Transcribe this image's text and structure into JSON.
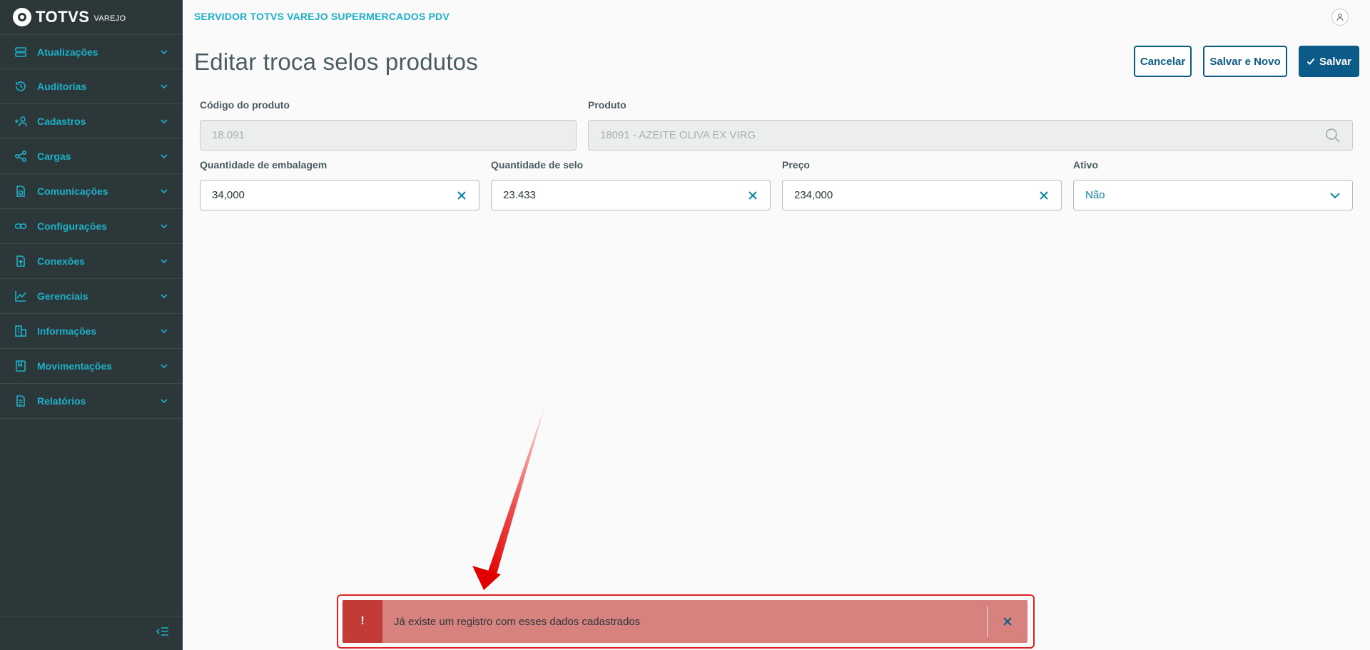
{
  "app": {
    "logo_text": "TOTVS",
    "logo_sub": "VAREJO",
    "title": "SERVIDOR TOTVS VAREJO SUPERMERCADOS PDV"
  },
  "sidebar": {
    "items": [
      {
        "label": "Atualizações",
        "icon": "server-icon"
      },
      {
        "label": "Auditorias",
        "icon": "history-icon"
      },
      {
        "label": "Cadastros",
        "icon": "add-user-icon"
      },
      {
        "label": "Cargas",
        "icon": "share-icon"
      },
      {
        "label": "Comunicações",
        "icon": "document-sync-icon"
      },
      {
        "label": "Configurações",
        "icon": "link-icon"
      },
      {
        "label": "Conexões",
        "icon": "document-upload-icon"
      },
      {
        "label": "Gerenciais",
        "icon": "chart-icon"
      },
      {
        "label": "Informações",
        "icon": "building-icon"
      },
      {
        "label": "Movimentações",
        "icon": "book-icon"
      },
      {
        "label": "Relatórios",
        "icon": "file-text-icon"
      }
    ]
  },
  "page": {
    "title": "Editar troca selos produtos"
  },
  "actions": {
    "cancel": "Cancelar",
    "save_new": "Salvar e Novo",
    "save": "Salvar"
  },
  "form": {
    "codigo": {
      "label": "Código do produto",
      "value": "18.091"
    },
    "produto": {
      "label": "Produto",
      "value": "18091 - AZEITE OLIVA EX VIRG"
    },
    "qtd_embalagem": {
      "label": "Quantidade de embalagem",
      "value": "34,000"
    },
    "qtd_selo": {
      "label": "Quantidade de selo",
      "value": "23.433"
    },
    "preco": {
      "label": "Preço",
      "value": "234,000"
    },
    "ativo": {
      "label": "Ativo",
      "value": "Não"
    }
  },
  "toast": {
    "icon": "!",
    "message": "Já existe um registro com esses dados cadastrados"
  },
  "colors": {
    "sidebar_bg": "#2c3739",
    "accent": "#1eb0c8",
    "primary": "#0c5a87",
    "error_bg": "#d88280",
    "error_icon_bg": "#c23b36"
  }
}
